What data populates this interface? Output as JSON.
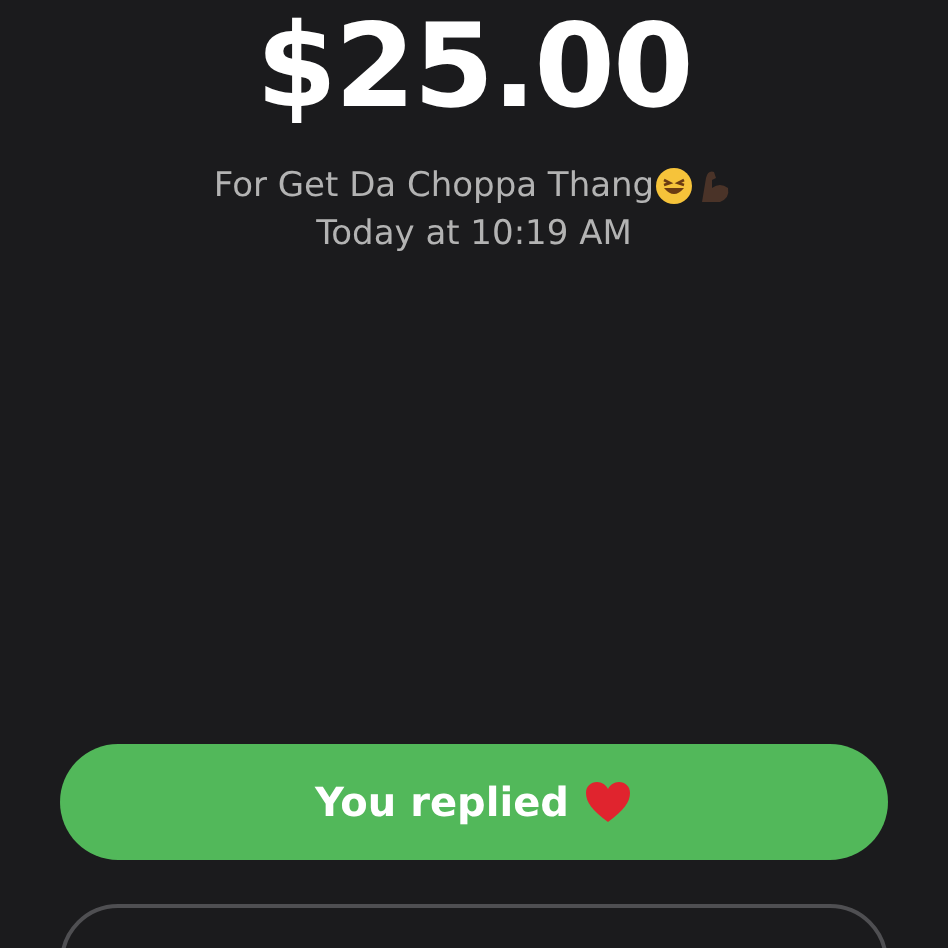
{
  "amount": "$25.00",
  "note": "For Get Da Choppa Thang",
  "time": "Today at 10:19 AM",
  "reply_button": {
    "label": "You replied"
  },
  "receipt_button": {
    "kind": "outline"
  }
}
